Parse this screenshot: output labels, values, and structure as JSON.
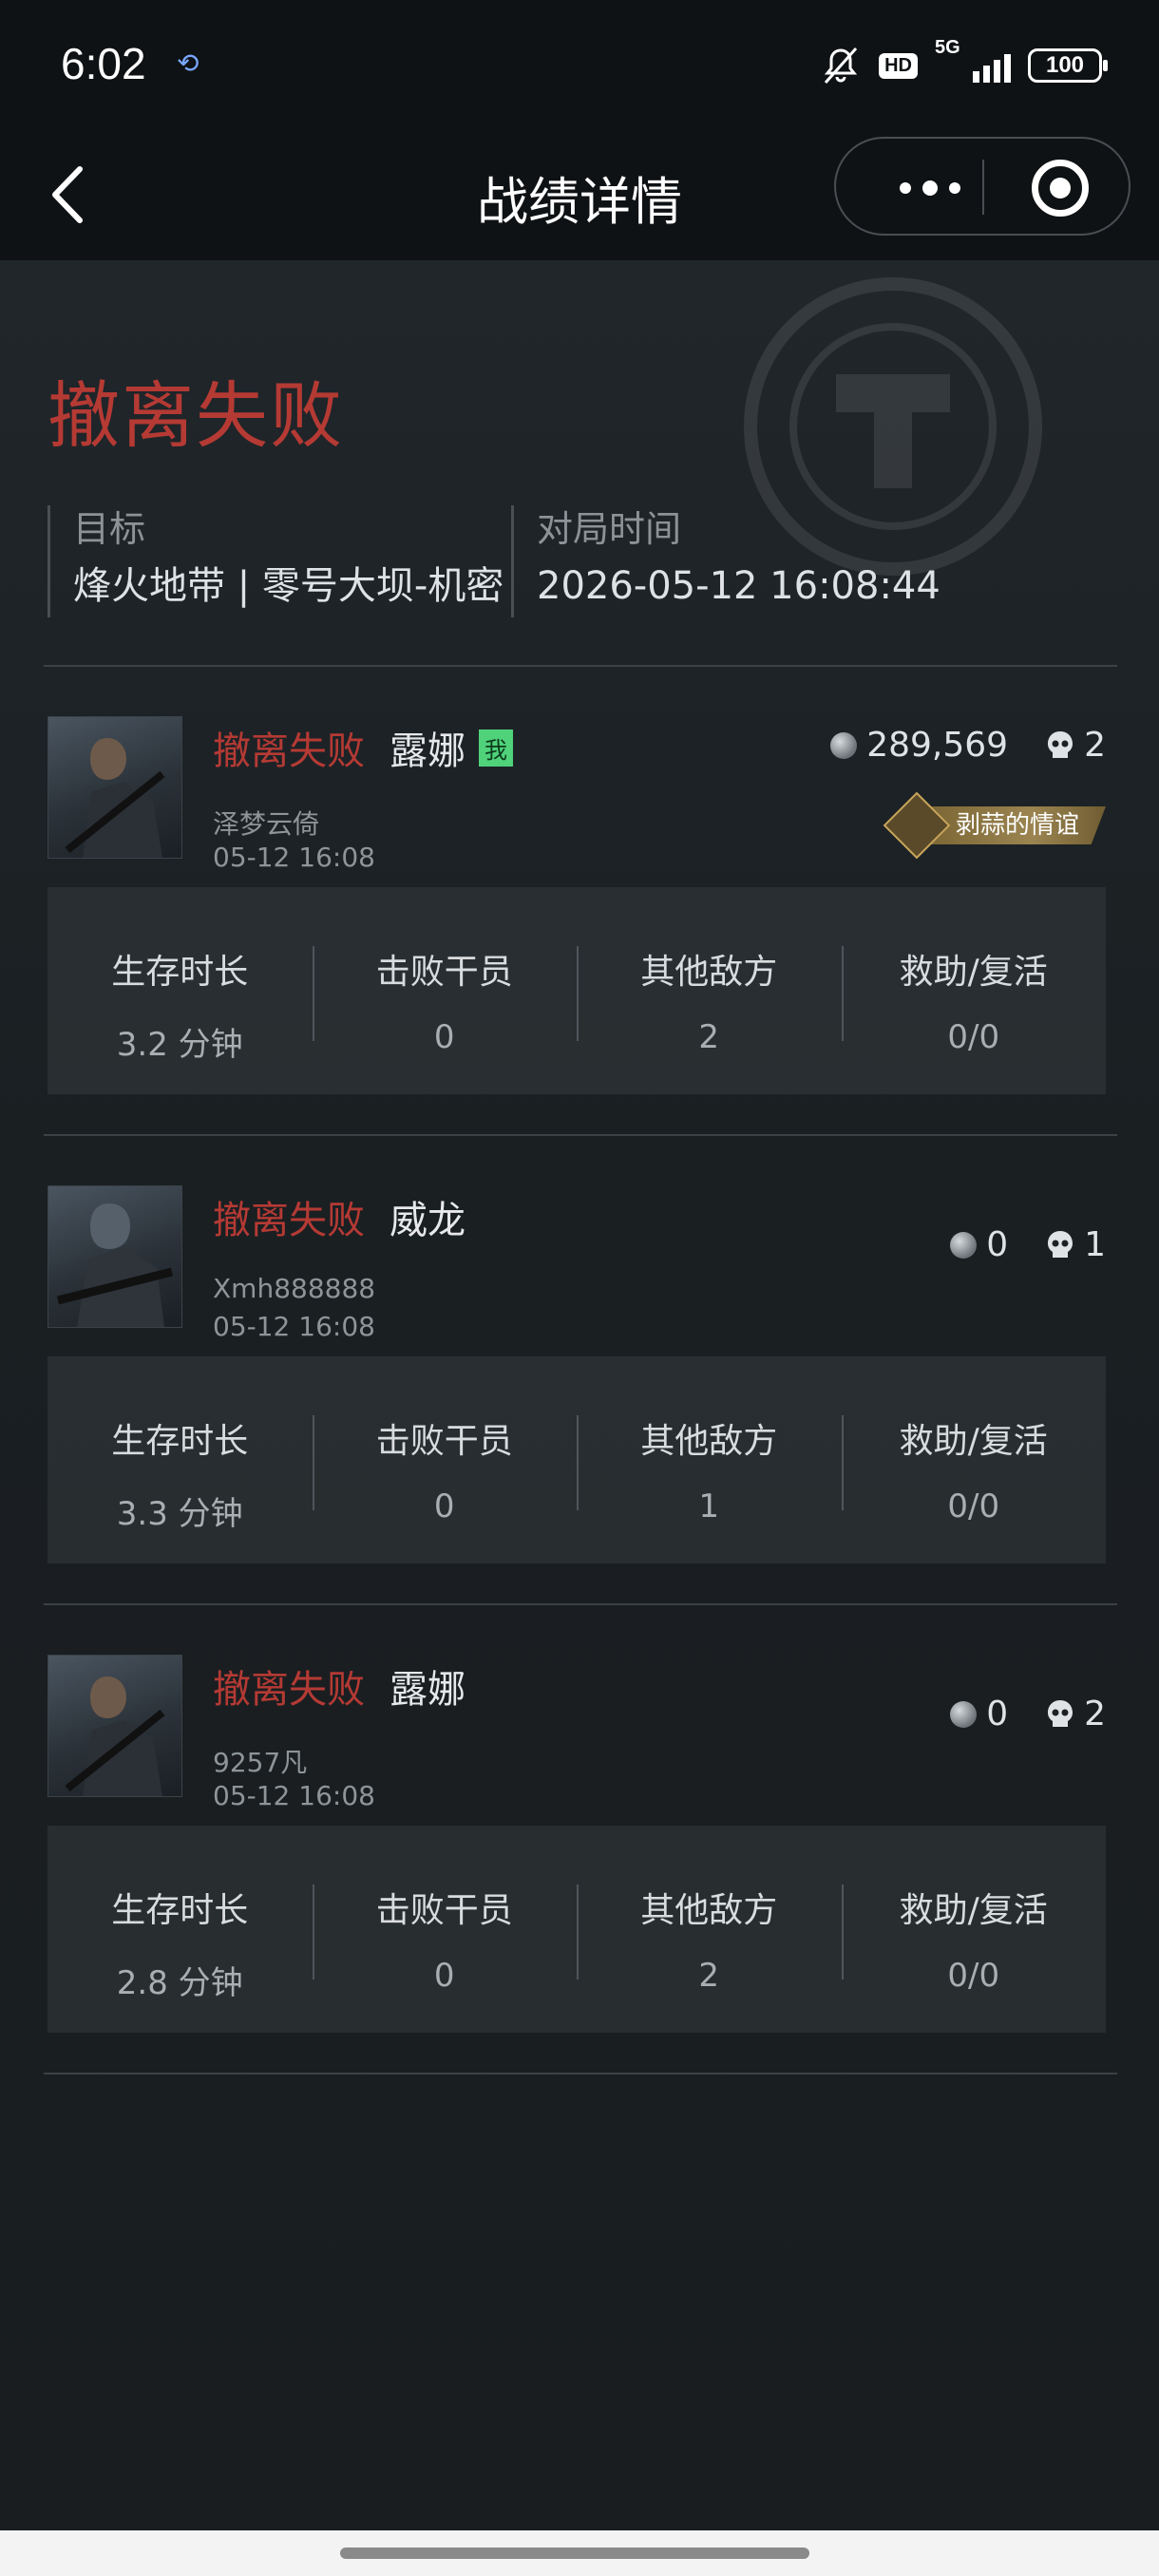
{
  "status_bar": {
    "time": "6:02",
    "hd_label": "HD",
    "network": "5G",
    "battery": "100"
  },
  "nav": {
    "title": "战绩详情"
  },
  "summary": {
    "result": "撤离失败",
    "target_label": "目标",
    "target_value": "烽火地带 | 零号大坝-机密",
    "time_label": "对局时间",
    "time_value": "2026-05-12 16:08:44"
  },
  "stat_labels": {
    "survival": "生存时长",
    "kills": "击败干员",
    "other": "其他敌方",
    "assist": "救助/复活"
  },
  "players": [
    {
      "status": "撤离失败",
      "name": "露娜",
      "me_badge": "我",
      "account": "泽梦云倚",
      "time": "05-12 16:08",
      "coins": "289,569",
      "skulls": "2",
      "tag": "剥蒜的情谊",
      "survival": "3.2 分钟",
      "kills": "0",
      "other": "2",
      "assist": "0/0"
    },
    {
      "status": "撤离失败",
      "name": "威龙",
      "account": "Xmh888888",
      "time": "05-12 16:08",
      "coins": "0",
      "skulls": "1",
      "survival": "3.3 分钟",
      "kills": "0",
      "other": "1",
      "assist": "0/0"
    },
    {
      "status": "撤离失败",
      "name": "露娜",
      "account": "9257凡",
      "time": "05-12 16:08",
      "coins": "0",
      "skulls": "2",
      "survival": "2.8 分钟",
      "kills": "0",
      "other": "2",
      "assist": "0/0"
    }
  ]
}
